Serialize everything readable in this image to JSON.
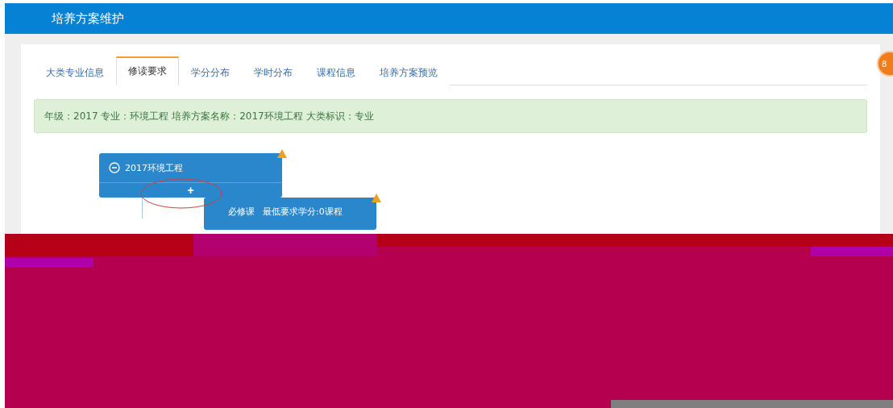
{
  "header": {
    "title": "培养方案维护"
  },
  "tabs": [
    {
      "label": "大类专业信息",
      "selected": false
    },
    {
      "label": "修读要求",
      "selected": true
    },
    {
      "label": "学分分布",
      "selected": false
    },
    {
      "label": "学时分布",
      "selected": false
    },
    {
      "label": "课程信息",
      "selected": false
    },
    {
      "label": "培养方案预览",
      "selected": false
    }
  ],
  "info": "年级：2017 专业：环境工程 培养方案名称：2017环境工程 大类标识：专业",
  "tree": {
    "label": "2017环境工程",
    "expanded": true,
    "add": "+",
    "children": [
      {
        "label": "必修课",
        "requirement": "最低要求学分:0课程"
      }
    ]
  },
  "badge": "8"
}
